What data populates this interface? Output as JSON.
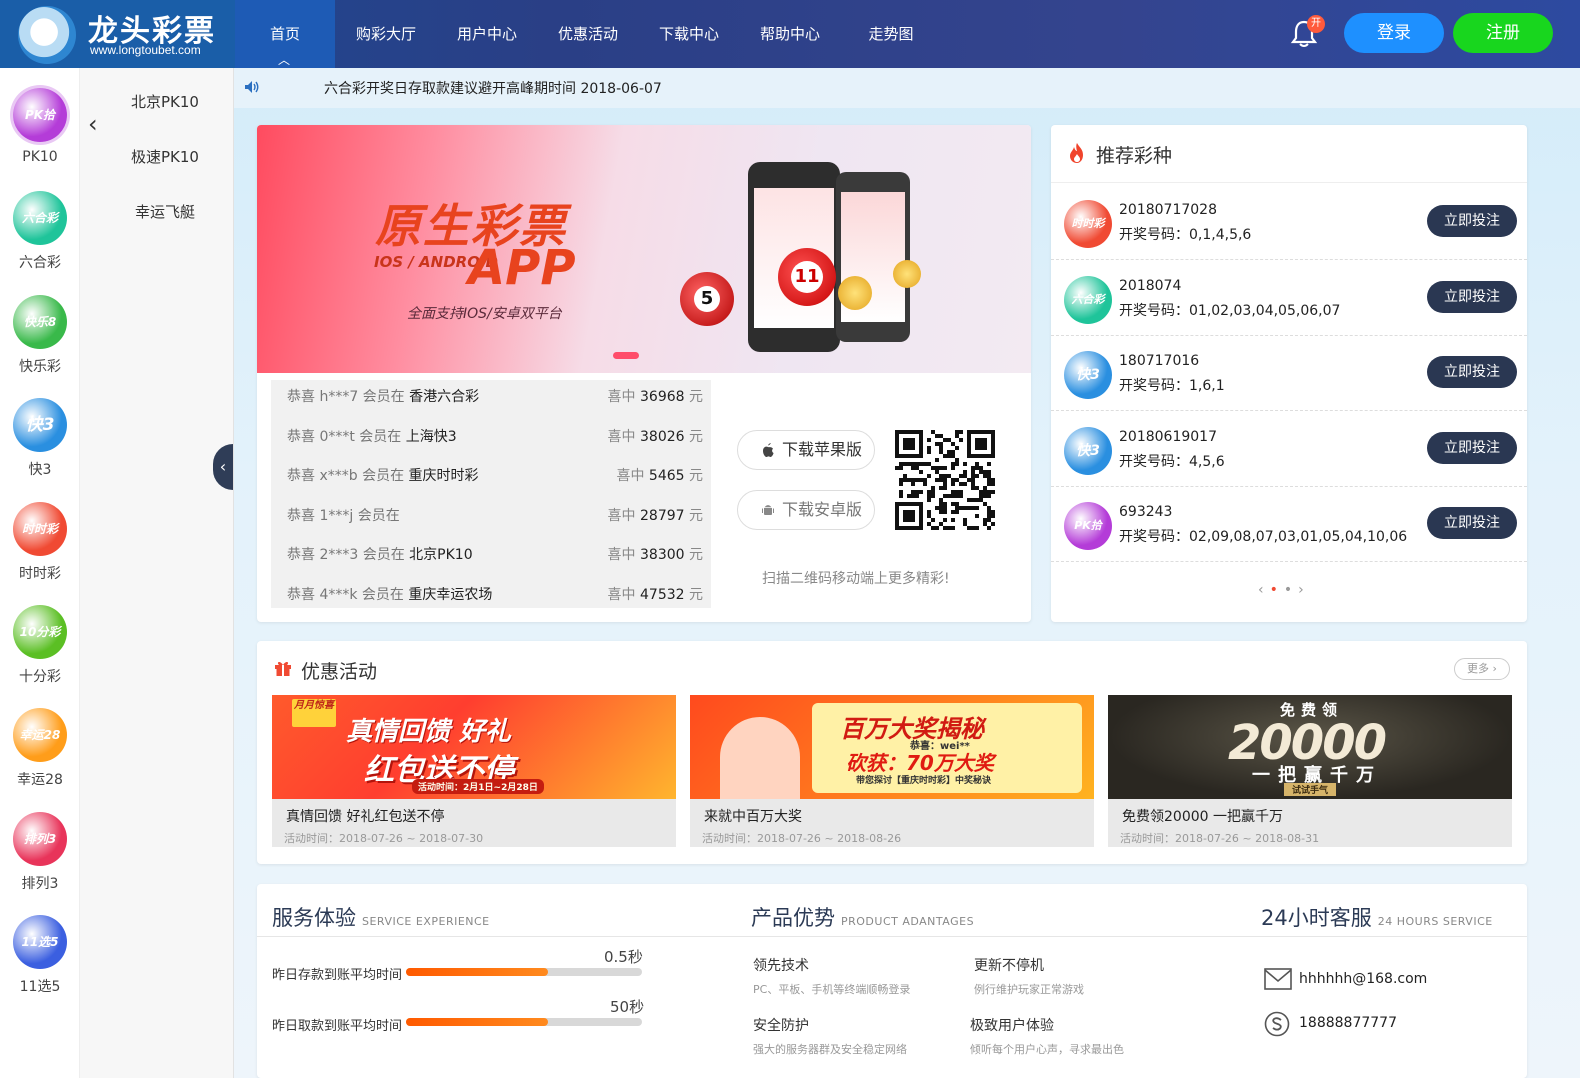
{
  "brand": {
    "name": "龙头彩票",
    "url": "www.longtoubet.com"
  },
  "nav": [
    "首页",
    "购彩大厅",
    "用户中心",
    "优惠活动",
    "下载中心",
    "帮助中心",
    "走势图"
  ],
  "header": {
    "bell_badge": "开",
    "login": "登录",
    "register": "注册"
  },
  "sidebar": [
    {
      "label": "PK10",
      "icon_text": "PK拾",
      "color": "#b43cd8"
    },
    {
      "label": "六合彩",
      "icon_text": "六合彩",
      "color": "#1fc49a"
    },
    {
      "label": "快乐彩",
      "icon_text": "快乐8",
      "color": "#39b94a"
    },
    {
      "label": "快3",
      "icon_text": "快3",
      "color": "#2a8fe0"
    },
    {
      "label": "时时彩",
      "icon_text": "时时彩",
      "color": "#f04a33"
    },
    {
      "label": "十分彩",
      "icon_text": "10分彩",
      "color": "#5bbf24"
    },
    {
      "label": "幸运28",
      "icon_text": "幸运28",
      "color": "#ff9d1a"
    },
    {
      "label": "排列3",
      "icon_text": "排列3",
      "color": "#e8345a"
    },
    {
      "label": "11选5",
      "icon_text": "11选5",
      "color": "#3b5fe0"
    }
  ],
  "submenu": [
    "北京PK10",
    "极速PK10",
    "幸运飞艇"
  ],
  "notice": "六合彩开奖日存取款建议避开高峰期时间 2018-06-07",
  "banner": {
    "title": "原生彩票",
    "platform": "IOS / ANDROID",
    "app": "APP",
    "subtitle": "全面支持IOS/安卓双平台"
  },
  "winners": [
    {
      "prefix": "恭喜 h***7 会员在",
      "game": "香港六合彩",
      "win": "喜中",
      "amount": "36968",
      "unit": "元"
    },
    {
      "prefix": "恭喜 0***t 会员在",
      "game": "上海快3",
      "win": "喜中",
      "amount": "38026",
      "unit": "元"
    },
    {
      "prefix": "恭喜 x***b 会员在",
      "game": "重庆时时彩",
      "win": "喜中",
      "amount": "5465",
      "unit": "元"
    },
    {
      "prefix": "恭喜 1***j 会员在",
      "game": "",
      "win": "喜中",
      "amount": "28797",
      "unit": "元"
    },
    {
      "prefix": "恭喜 2***3 会员在",
      "game": "北京PK10",
      "win": "喜中",
      "amount": "38300",
      "unit": "元"
    },
    {
      "prefix": "恭喜 4***k 会员在",
      "game": "重庆幸运农场",
      "win": "喜中",
      "amount": "47532",
      "unit": "元"
    }
  ],
  "download": {
    "ios": "下载苹果版",
    "android": "下载安卓版",
    "qr_hint": "扫描二维码移动端上更多精彩!"
  },
  "recommend": {
    "title": "推荐彩种",
    "button": "立即投注",
    "items": [
      {
        "issue": "20180717028",
        "label": "开奖号码：",
        "numbers": "0,1,4,5,6",
        "icon_text": "时时彩",
        "color": "#f04a33"
      },
      {
        "issue": "2018074",
        "label": "开奖号码：",
        "numbers": "01,02,03,04,05,06,07",
        "icon_text": "六合彩",
        "color": "#1fc49a"
      },
      {
        "issue": "180717016",
        "label": "开奖号码：",
        "numbers": "1,6,1",
        "icon_text": "快3",
        "color": "#2a8fe0"
      },
      {
        "issue": "20180619017",
        "label": "开奖号码：",
        "numbers": "4,5,6",
        "icon_text": "快3",
        "color": "#2a8fe0"
      },
      {
        "issue": "693243",
        "label": "开奖号码：",
        "numbers": "02,09,08,07,03,01,05,04,10,06",
        "icon_text": "PK拾",
        "color": "#b43cd8"
      }
    ]
  },
  "promo": {
    "title": "优惠活动",
    "more": "更多",
    "items": [
      {
        "name": "真情回馈 好礼红包送不停",
        "date": "活动时间：2018-07-26 ~ 2018-07-30",
        "art_tag": "月月惊喜",
        "art_line1": "真情回馈 好礼",
        "art_line2": "红包送不停",
        "art_small": "活动时间：2月1日~2月28日"
      },
      {
        "name": "来就中百万大奖",
        "date": "活动时间：2018-07-26 ~ 2018-08-26",
        "art_line1": "百万大奖揭秘",
        "art_line2": "砍获：70万大奖",
        "art_small": "带您探讨【重庆时时彩】中奖秘诀",
        "art_tag": "恭喜：wei**"
      },
      {
        "name": "免费领20000 一把赢千万",
        "date": "活动时间：2018-07-26 ~ 2018-08-31",
        "art_tag": "免费领",
        "art_line1": "20000",
        "art_line2": "一把赢千万",
        "art_small": "试试手气"
      }
    ]
  },
  "service": {
    "title": "服务体验",
    "title_en": "SERVICE EXPERIENCE",
    "stats": [
      {
        "label": "昨日存款到账平均时间",
        "value": "0.5秒",
        "fill": 0.6
      },
      {
        "label": "昨日取款到账平均时间",
        "value": "50秒",
        "fill": 0.6
      }
    ]
  },
  "advantages": {
    "title": "产品优势",
    "title_en": "PRODUCT ADANTAGES",
    "items": [
      {
        "title": "领先技术",
        "desc": "PC、平板、手机等终端顺畅登录"
      },
      {
        "title": "更新不停机",
        "desc": "例行维护玩家正常游戏"
      },
      {
        "title": "安全防护",
        "desc": "强大的服务器群及安全稳定网络"
      },
      {
        "title": "极致用户体验",
        "desc": "倾听每个用户心声，寻求最出色"
      }
    ]
  },
  "support": {
    "title": "24小时客服",
    "title_en": "24 HOURS SERVICE",
    "email": "hhhhhh@168.com",
    "phone": "18888877777"
  }
}
